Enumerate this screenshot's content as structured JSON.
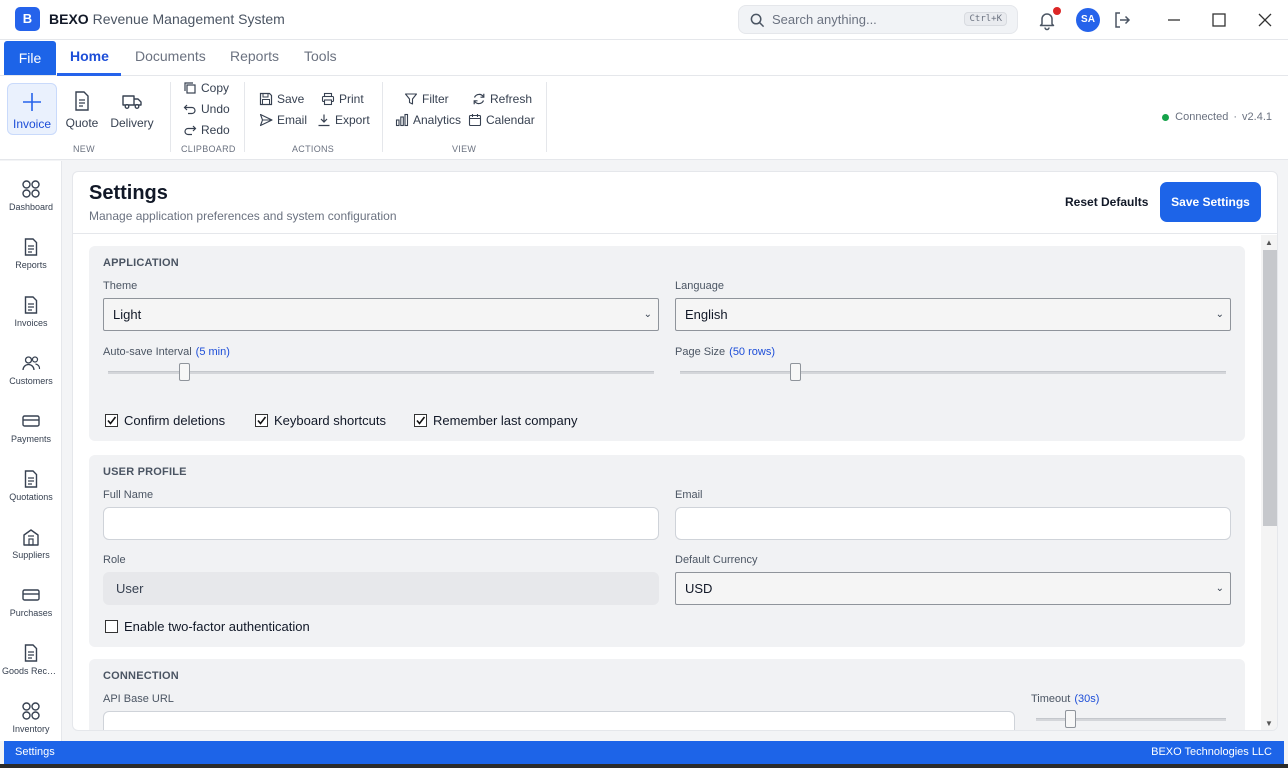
{
  "app": {
    "logo_letter": "B",
    "name_bold": "BEXO",
    "name_rest": " Revenue Management System",
    "search_placeholder": "Search anything...",
    "search_shortcut": "Ctrl+K",
    "user_initials": "SA"
  },
  "menu": {
    "file": "File",
    "tabs": [
      "Home",
      "Documents",
      "Reports",
      "Tools"
    ],
    "active_tab": "Home"
  },
  "ribbon": {
    "new": {
      "label": "NEW",
      "items": [
        "Invoice",
        "Quote",
        "Delivery"
      ]
    },
    "clipboard": {
      "label": "CLIPBOARD",
      "items": [
        "Copy",
        "Undo",
        "Redo"
      ]
    },
    "actions": {
      "label": "ACTIONS",
      "items": [
        "Save",
        "Print",
        "Email",
        "Export"
      ]
    },
    "view": {
      "label": "VIEW",
      "items": [
        "Filter",
        "Refresh",
        "Analytics",
        "Calendar"
      ]
    },
    "status": "Connected",
    "version": "v2.4.1",
    "separator": "·"
  },
  "sidebar": {
    "items": [
      "Dashboard",
      "Reports",
      "Invoices",
      "Customers",
      "Payments",
      "Quotations",
      "Suppliers",
      "Purchases",
      "Goods Received",
      "Inventory"
    ]
  },
  "settings": {
    "title": "Settings",
    "subtitle": "Manage application preferences and system configuration",
    "reset_label": "Reset Defaults",
    "save_label": "Save Settings",
    "application": {
      "title": "APPLICATION",
      "theme_label": "Theme",
      "theme_value": "Light",
      "language_label": "Language",
      "language_value": "English",
      "autosave_label": "Auto-save Interval",
      "autosave_value": "(5 min)",
      "autosave_fraction": 0.14,
      "pagesize_label": "Page Size",
      "pagesize_value": "(50 rows)",
      "pagesize_fraction": 0.21,
      "checks": [
        {
          "label": "Confirm deletions",
          "checked": true
        },
        {
          "label": "Keyboard shortcuts",
          "checked": true
        },
        {
          "label": "Remember last company",
          "checked": true
        }
      ]
    },
    "user_profile": {
      "title": "USER PROFILE",
      "fullname_label": "Full Name",
      "fullname_value": "",
      "email_label": "Email",
      "email_value": "",
      "role_label": "Role",
      "role_value": "User",
      "currency_label": "Default Currency",
      "currency_value": "USD",
      "twofa_label": "Enable two-factor authentication",
      "twofa_checked": false
    },
    "connection": {
      "title": "CONNECTION",
      "api_label": "API Base URL",
      "api_value": "",
      "timeout_label": "Timeout",
      "timeout_value": "(30s)",
      "timeout_fraction": 0.18
    }
  },
  "statusbar": {
    "left": "Settings",
    "right": "BEXO Technologies LLC"
  },
  "colors": {
    "accent": "#1d64e8",
    "status_ok": "#16a34a",
    "notification": "#dc2626"
  }
}
